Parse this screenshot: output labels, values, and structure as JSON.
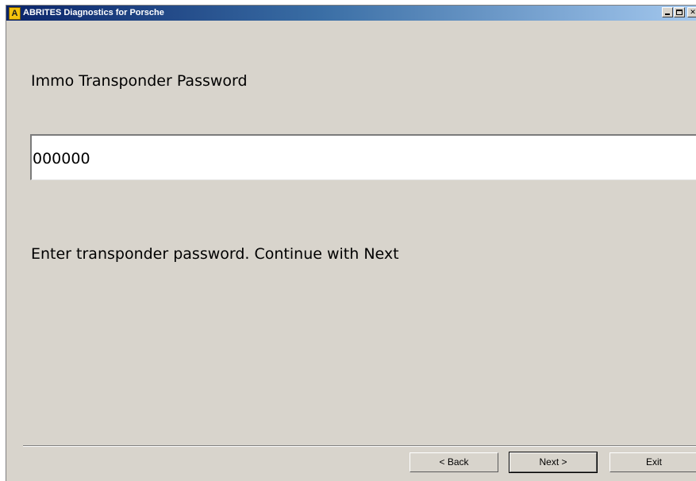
{
  "window": {
    "title": "ABRITES Diagnostics for Porsche",
    "app_icon_letter": "A"
  },
  "page": {
    "heading": "Immo Transponder Password",
    "password_value": "000000",
    "instruction": "Enter transponder password. Continue with Next"
  },
  "buttons": {
    "back": "< Back",
    "next": "Next >",
    "exit": "Exit"
  },
  "colors": {
    "window_bg": "#d8d4cc",
    "titlebar_start": "#0a246a",
    "titlebar_end": "#a6caf0",
    "app_icon": "#f4c20d"
  }
}
